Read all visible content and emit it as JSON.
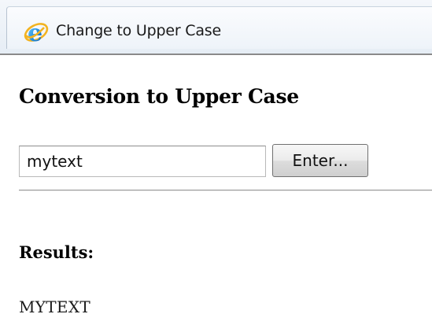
{
  "browser": {
    "tab_title": "Change to Upper Case",
    "tab_icon": "internet-explorer-icon"
  },
  "form": {
    "heading": "Conversion to Upper Case",
    "input_value": "mytext",
    "button_label": "Enter..."
  },
  "results": {
    "heading": "Results:",
    "value": "MYTEXT"
  }
}
